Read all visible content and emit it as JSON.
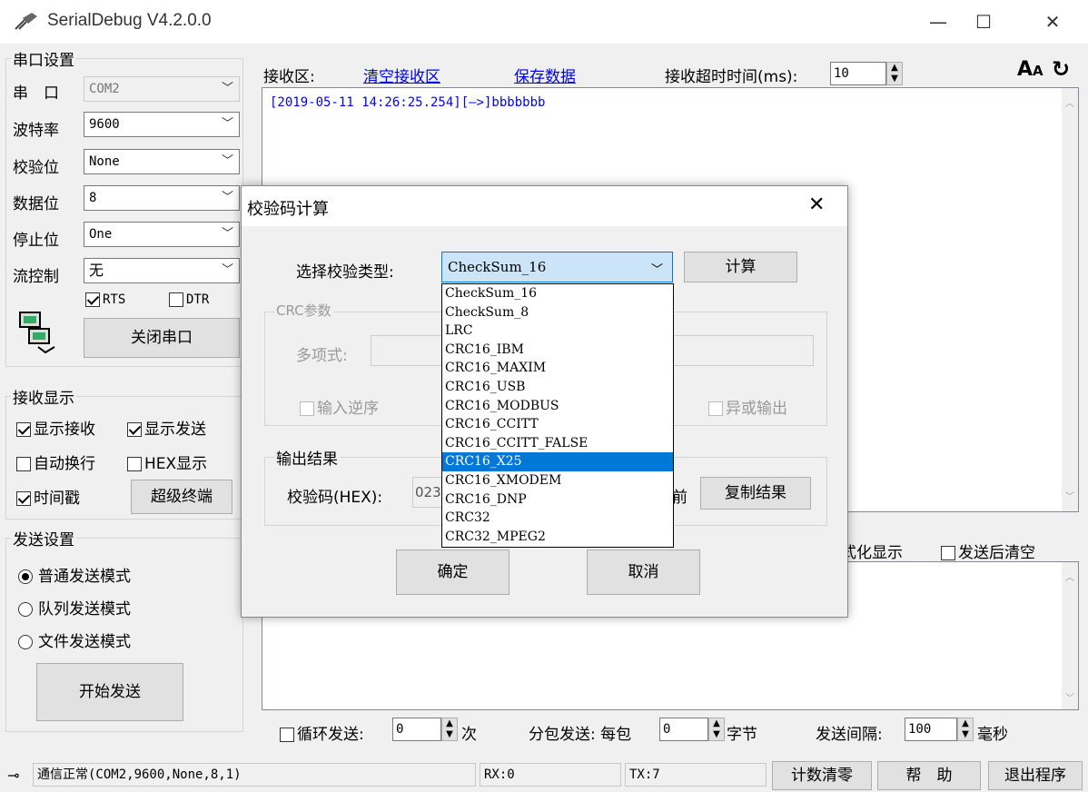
{
  "app": {
    "title": "SerialDebug V4.2.0.0",
    "min": "—",
    "max": "☐",
    "close": "✕"
  },
  "serial": {
    "group_title": "串口设置",
    "port_label": "串　口",
    "port_value": "COM2",
    "baud_label": "波特率",
    "baud_value": "9600",
    "parity_label": "校验位",
    "parity_value": "None",
    "data_label": "数据位",
    "data_value": "8",
    "stop_label": "停止位",
    "stop_value": "One",
    "flow_label": "流控制",
    "flow_value": "无",
    "rts_label": "RTS",
    "rts_checked": true,
    "dtr_label": "DTR",
    "dtr_checked": false,
    "close_port_label": "关闭串口"
  },
  "receive_display": {
    "group_title": "接收显示",
    "show_recv": "显示接收",
    "show_send": "显示发送",
    "auto_wrap": "自动换行",
    "hex_display": "HEX显示",
    "timestamp": "时间戳",
    "super_term": "超级终端"
  },
  "send_settings": {
    "group_title": "发送设置",
    "normal_mode": "普通发送模式",
    "queue_mode": "队列发送模式",
    "file_mode": "文件发送模式",
    "start_send": "开始发送"
  },
  "recv_area": {
    "label": "接收区:",
    "clear_link": "清空接收区",
    "save_link": "保存数据",
    "timeout_label": "接收超时时间(ms):",
    "timeout_value": "10",
    "log_line": "[2019-05-11 14:26:25.254][—>]bbbbbbb"
  },
  "send_area": {
    "format_display": "式化显示",
    "clear_after_send": "发送后清空",
    "loop_send_label": "循环发送:",
    "loop_value": "0",
    "loop_unit": "次",
    "packet_label": "分包发送: 每包",
    "packet_value": "0",
    "packet_unit": "字节",
    "interval_label": "发送间隔:",
    "interval_value": "100",
    "interval_unit": "毫秒"
  },
  "statusbar": {
    "status": "通信正常(COM2,9600,None,8,1)",
    "rx": "RX:0",
    "tx": "TX:7",
    "reset_count": "计数清零",
    "help": "帮　助",
    "exit": "退出程序"
  },
  "dialog": {
    "title": "校验码计算",
    "select_label": "选择校验类型:",
    "selected_type": "CheckSum_16",
    "calc_button": "计算",
    "crc_group": "CRC参数",
    "poly_label": "多项式:",
    "input_reverse": "输入逆序",
    "xor_output": "异或输出",
    "output_group": "输出结果",
    "checksum_label": "校验码(HEX):",
    "checksum_value": "023",
    "front_label": "前",
    "copy_button": "复制结果",
    "ok_button": "确定",
    "cancel_button": "取消",
    "options": [
      "CheckSum_16",
      "CheckSum_8",
      "LRC",
      "CRC16_IBM",
      "CRC16_MAXIM",
      "CRC16_USB",
      "CRC16_MODBUS",
      "CRC16_CCITT",
      "CRC16_CCITT_FALSE",
      "CRC16_X25",
      "CRC16_XMODEM",
      "CRC16_DNP",
      "CRC32",
      "CRC32_MPEG2"
    ],
    "highlighted_option": "CRC16_X25"
  }
}
